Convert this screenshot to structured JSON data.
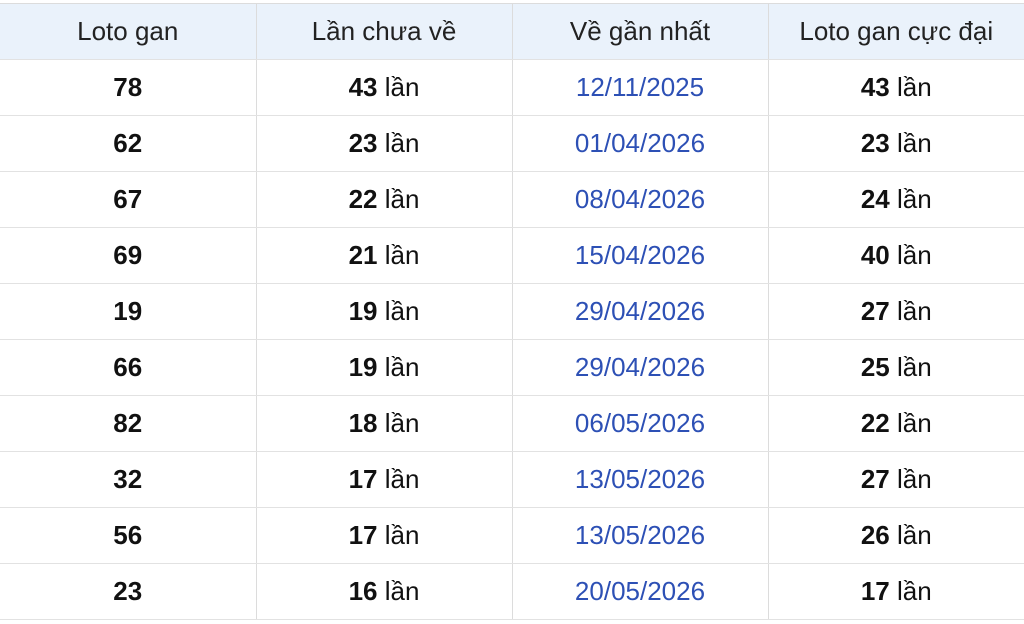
{
  "table": {
    "headers": [
      "Loto gan",
      "Lần chưa về",
      "Về gần nhất",
      "Loto gan cực đại"
    ],
    "unit": "lần",
    "rows": [
      {
        "loto": "78",
        "missed": "43",
        "last_seen": "12/11/2025",
        "max_gan": "43"
      },
      {
        "loto": "62",
        "missed": "23",
        "last_seen": "01/04/2026",
        "max_gan": "23"
      },
      {
        "loto": "67",
        "missed": "22",
        "last_seen": "08/04/2026",
        "max_gan": "24"
      },
      {
        "loto": "69",
        "missed": "21",
        "last_seen": "15/04/2026",
        "max_gan": "40"
      },
      {
        "loto": "19",
        "missed": "19",
        "last_seen": "29/04/2026",
        "max_gan": "27"
      },
      {
        "loto": "66",
        "missed": "19",
        "last_seen": "29/04/2026",
        "max_gan": "25"
      },
      {
        "loto": "82",
        "missed": "18",
        "last_seen": "06/05/2026",
        "max_gan": "22"
      },
      {
        "loto": "32",
        "missed": "17",
        "last_seen": "13/05/2026",
        "max_gan": "27"
      },
      {
        "loto": "56",
        "missed": "17",
        "last_seen": "13/05/2026",
        "max_gan": "26"
      },
      {
        "loto": "23",
        "missed": "16",
        "last_seen": "20/05/2026",
        "max_gan": "17"
      }
    ]
  },
  "colors": {
    "header_bg": "#eaf2fb",
    "date_text": "#2d50b5",
    "grid_line": "#dcdcdc"
  }
}
